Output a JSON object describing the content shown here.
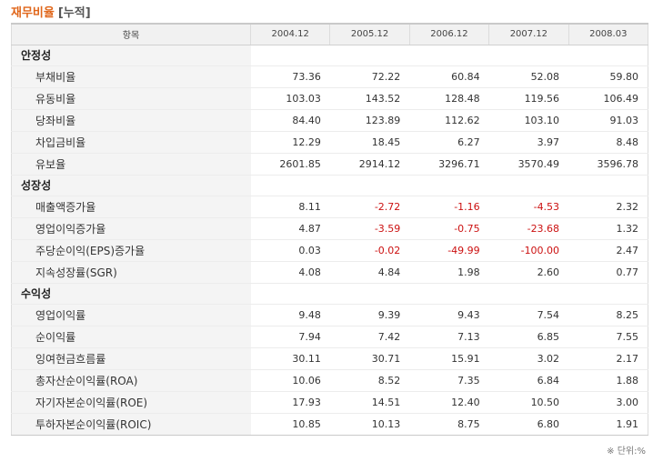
{
  "title": {
    "main": "재무비율",
    "sub": "[누적]"
  },
  "header": {
    "item_label": "항목",
    "years": [
      "2004.12",
      "2005.12",
      "2006.12",
      "2007.12",
      "2008.03"
    ]
  },
  "sections": [
    {
      "name": "안정성",
      "rows": [
        {
          "label": "부채비율",
          "values": [
            "73.36",
            "72.22",
            "60.84",
            "52.08",
            "59.80"
          ]
        },
        {
          "label": "유동비율",
          "values": [
            "103.03",
            "143.52",
            "128.48",
            "119.56",
            "106.49"
          ]
        },
        {
          "label": "당좌비율",
          "values": [
            "84.40",
            "123.89",
            "112.62",
            "103.10",
            "91.03"
          ]
        },
        {
          "label": "차입금비율",
          "values": [
            "12.29",
            "18.45",
            "6.27",
            "3.97",
            "8.48"
          ]
        },
        {
          "label": "유보율",
          "values": [
            "2601.85",
            "2914.12",
            "3296.71",
            "3570.49",
            "3596.78"
          ]
        }
      ]
    },
    {
      "name": "성장성",
      "rows": [
        {
          "label": "매출액증가율",
          "values": [
            "8.11",
            "-2.72",
            "-1.16",
            "-4.53",
            "2.32"
          ]
        },
        {
          "label": "영업이익증가율",
          "values": [
            "4.87",
            "-3.59",
            "-0.75",
            "-23.68",
            "1.32"
          ]
        },
        {
          "label": "주당순이익(EPS)증가율",
          "values": [
            "0.03",
            "-0.02",
            "-49.99",
            "-100.00",
            "2.47"
          ]
        },
        {
          "label": "지속성장률(SGR)",
          "values": [
            "4.08",
            "4.84",
            "1.98",
            "2.60",
            "0.77"
          ]
        }
      ]
    },
    {
      "name": "수익성",
      "rows": [
        {
          "label": "영업이익률",
          "values": [
            "9.48",
            "9.39",
            "9.43",
            "7.54",
            "8.25"
          ]
        },
        {
          "label": "순이익률",
          "values": [
            "7.94",
            "7.42",
            "7.13",
            "6.85",
            "7.55"
          ]
        },
        {
          "label": "잉여현금흐름률",
          "values": [
            "30.11",
            "30.71",
            "15.91",
            "3.02",
            "2.17"
          ]
        },
        {
          "label": "총자산순이익률(ROA)",
          "values": [
            "10.06",
            "8.52",
            "7.35",
            "6.84",
            "1.88"
          ]
        },
        {
          "label": "자기자본순이익률(ROE)",
          "values": [
            "17.93",
            "14.51",
            "12.40",
            "10.50",
            "3.00"
          ]
        },
        {
          "label": "투하자본순이익률(ROIC)",
          "values": [
            "10.85",
            "10.13",
            "8.75",
            "6.80",
            "1.91"
          ]
        }
      ]
    }
  ],
  "unit_note": "※ 단위:%",
  "colors": {
    "title": "#e0661a",
    "negative": "#cc1111",
    "label_bg": "#f4f4f4",
    "header_bg": "#f1f1f1"
  }
}
